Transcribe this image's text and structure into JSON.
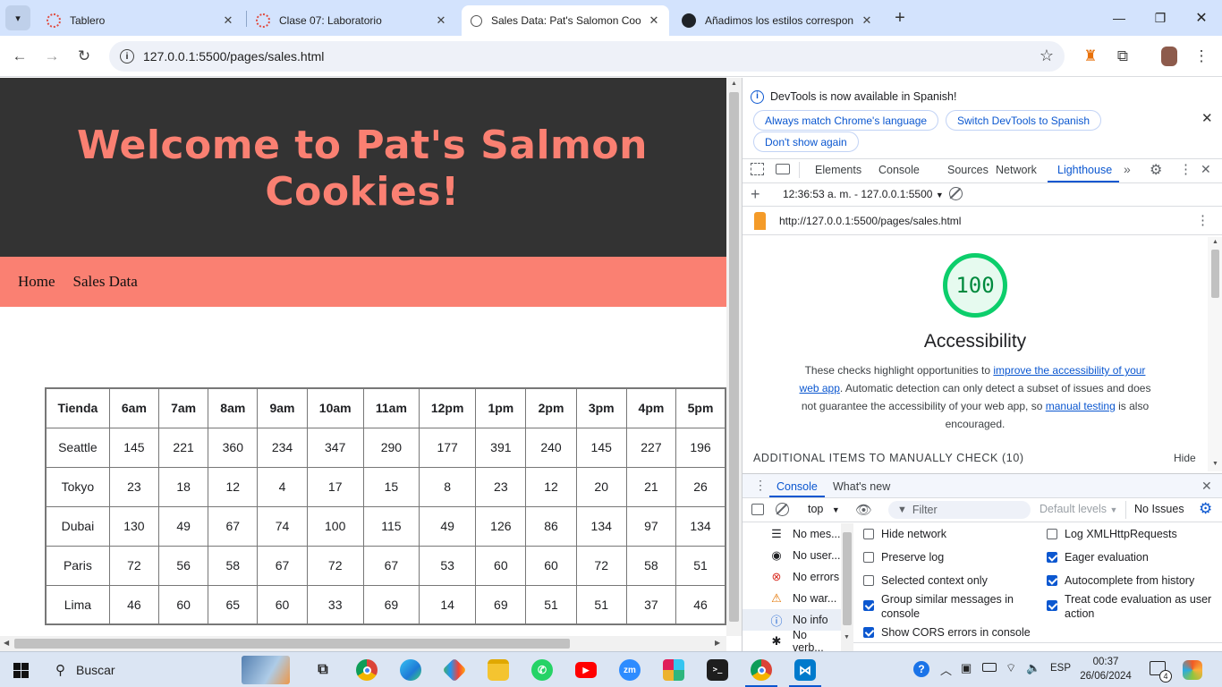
{
  "tabs": [
    {
      "title": "Tablero"
    },
    {
      "title": "Clase 07: Laboratorio"
    },
    {
      "title": "Sales Data: Pat's Salomon Cook"
    },
    {
      "title": "Añadimos los estilos correspon"
    }
  ],
  "address": "127.0.0.1:5500/pages/sales.html",
  "page": {
    "title": "Welcome to Pat's Salmon Cookies!",
    "nav": [
      "Home",
      "Sales Data"
    ],
    "table": {
      "headers": [
        "Tienda",
        "6am",
        "7am",
        "8am",
        "9am",
        "10am",
        "11am",
        "12pm",
        "1pm",
        "2pm",
        "3pm",
        "4pm",
        "5pm"
      ],
      "rows": [
        [
          "Seattle",
          "145",
          "221",
          "360",
          "234",
          "347",
          "290",
          "177",
          "391",
          "240",
          "145",
          "227",
          "196"
        ],
        [
          "Tokyo",
          "23",
          "18",
          "12",
          "4",
          "17",
          "15",
          "8",
          "23",
          "12",
          "20",
          "21",
          "26"
        ],
        [
          "Dubai",
          "130",
          "49",
          "67",
          "74",
          "100",
          "115",
          "49",
          "126",
          "86",
          "134",
          "97",
          "134"
        ],
        [
          "Paris",
          "72",
          "56",
          "58",
          "67",
          "72",
          "67",
          "53",
          "60",
          "60",
          "72",
          "58",
          "51"
        ],
        [
          "Lima",
          "46",
          "60",
          "65",
          "60",
          "33",
          "69",
          "14",
          "69",
          "51",
          "51",
          "37",
          "46"
        ]
      ]
    }
  },
  "devtools": {
    "infobar": {
      "message": "DevTools is now available in Spanish!",
      "btn_match": "Always match Chrome's language",
      "btn_switch": "Switch DevTools to Spanish",
      "btn_dont": "Don't show again"
    },
    "tabs": [
      "Elements",
      "Console",
      "Sources",
      "Network",
      "Lighthouse"
    ],
    "report_time": "12:36:53 a. m. - 127.0.0.1:5500",
    "report_url": "http://127.0.0.1:5500/pages/sales.html",
    "lighthouse": {
      "score": "100",
      "category": "Accessibility",
      "desc_1": "These checks highlight opportunities to ",
      "link_1": "improve the accessibility of your web app",
      "desc_2": ". Automatic detection can only detect a subset of issues and does not guarantee the accessibility of your web app, so ",
      "link_2": "manual testing",
      "desc_3": " is also encouraged.",
      "manual_heading": "ADDITIONAL ITEMS TO MANUALLY CHECK (10)",
      "hide_label": "Hide"
    },
    "drawer": {
      "tab_console": "Console",
      "tab_whatsnew": "What's new",
      "context": "top",
      "filter_placeholder": "Filter",
      "levels": "Default levels",
      "issues": "No Issues",
      "sidebar": [
        "No mes...",
        "No user...",
        "No errors",
        "No war...",
        "No info",
        "No verb..."
      ],
      "options_left": [
        "Hide network",
        "Preserve log",
        "Selected context only",
        "Group similar messages in console",
        "Show CORS errors in console"
      ],
      "options_right": [
        "Log XMLHttpRequests",
        "Eager evaluation",
        "Autocomplete from history",
        "Treat code evaluation as user action"
      ]
    }
  },
  "taskbar": {
    "search": "Buscar",
    "lang": "ESP",
    "time": "00:37",
    "date": "26/06/2024",
    "notif_count": "4"
  }
}
